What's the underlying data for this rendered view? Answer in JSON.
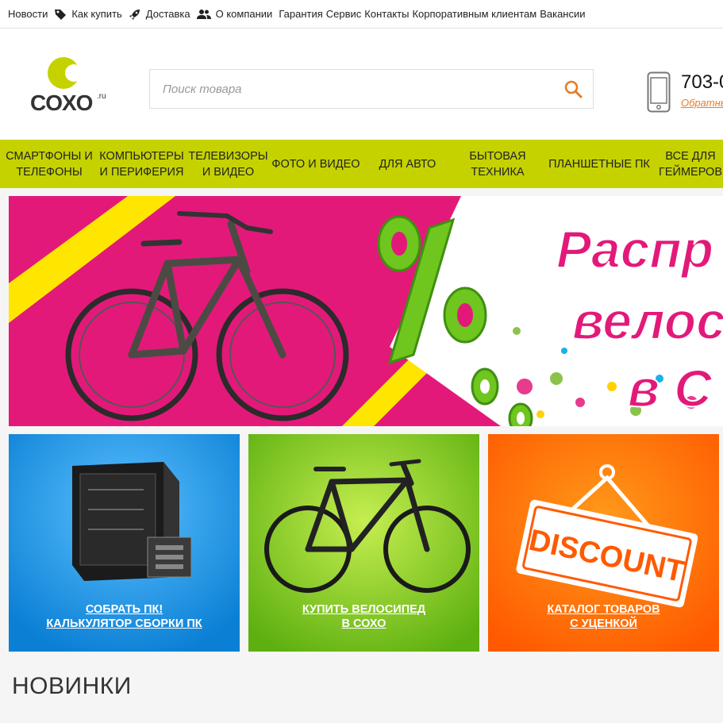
{
  "topbar": {
    "news": "Новости",
    "how_to_buy": "Как купить",
    "delivery": "Доставка",
    "about": "О компании",
    "warranty": "Гарантия",
    "service": "Сервис",
    "contacts": "Контакты",
    "corporate": "Корпоративным клиентам",
    "vacancies": "Вакансии"
  },
  "header": {
    "logo_text": "COXO",
    "logo_suffix": ".ru",
    "search_placeholder": "Поиск товара",
    "phone": "703-0",
    "callback": "Обратный"
  },
  "nav": {
    "items": [
      {
        "label": "СМАРТФОНЫ И ТЕЛЕФОНЫ"
      },
      {
        "label": "КОМПЬЮТЕРЫ И ПЕРИФЕРИЯ"
      },
      {
        "label": "ТЕЛЕВИЗОРЫ И ВИДЕО"
      },
      {
        "label": "ФОТО И ВИДЕО"
      },
      {
        "label": "ДЛЯ АВТО"
      },
      {
        "label": "БЫТОВАЯ ТЕХНИКА"
      },
      {
        "label": "ПЛАНШЕТНЫЕ ПК"
      },
      {
        "label": "ВСЕ ДЛЯ ГЕЙМЕРОВ"
      }
    ]
  },
  "banner": {
    "line1": "Распр",
    "line2": "велос",
    "line3": "в С"
  },
  "tiles": [
    {
      "line1": "СОБРАТЬ ПК!",
      "line2": "КАЛЬКУЛЯТОР СБОРКИ ПК",
      "color": "#1a8fdc"
    },
    {
      "line1": "КУПИТЬ ВЕЛОСИПЕД",
      "line2": "В СОХО",
      "color": "#6fbf14"
    },
    {
      "line1": "КАТАЛОГ ТОВАРОВ",
      "line2": "С УЦЕНКОЙ",
      "color": "#ff6a00",
      "sign_text": "DISCOUNT"
    }
  ],
  "section": {
    "title": "НОВИНКИ"
  },
  "colors": {
    "accent": "#c5d200",
    "link_orange": "#e67e22"
  }
}
